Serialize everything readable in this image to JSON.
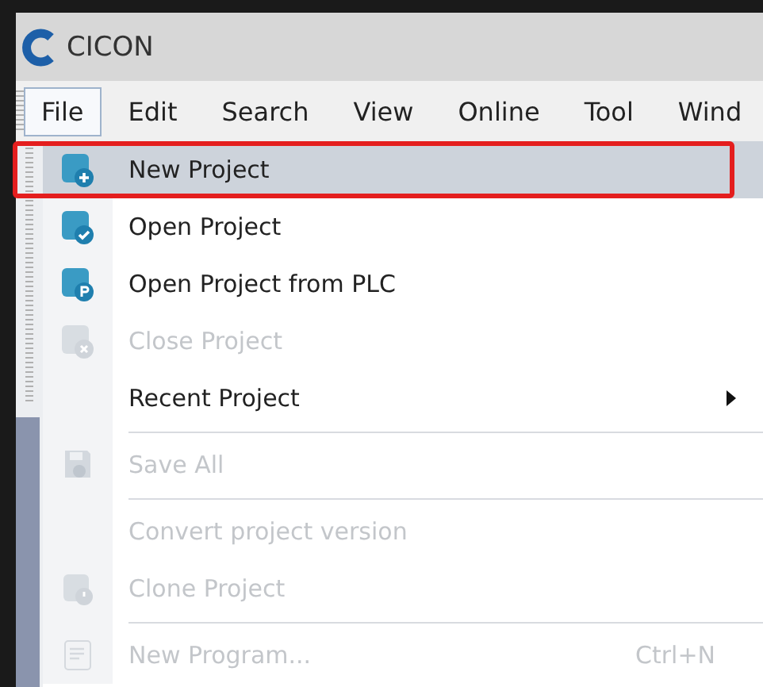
{
  "window": {
    "title": "CICON"
  },
  "menu_bar": [
    {
      "label": "File",
      "selected": true
    },
    {
      "label": "Edit",
      "selected": false
    },
    {
      "label": "Search",
      "selected": false
    },
    {
      "label": "View",
      "selected": false
    },
    {
      "label": "Online",
      "selected": false
    },
    {
      "label": "Tool",
      "selected": false
    },
    {
      "label": "Wind",
      "selected": false
    }
  ],
  "file_menu": [
    {
      "kind": "item",
      "label": "New Project",
      "disabled": false,
      "highlighted": true,
      "submenu": false
    },
    {
      "kind": "item",
      "label": "Open Project",
      "disabled": false,
      "highlighted": false,
      "submenu": false
    },
    {
      "kind": "item",
      "label": "Open Project from PLC",
      "disabled": false,
      "highlighted": false,
      "submenu": false
    },
    {
      "kind": "item",
      "label": "Close Project",
      "disabled": true,
      "highlighted": false,
      "submenu": false
    },
    {
      "kind": "item",
      "label": "Recent Project",
      "disabled": false,
      "highlighted": false,
      "submenu": true
    },
    {
      "kind": "separator"
    },
    {
      "kind": "item",
      "label": "Save All",
      "disabled": true,
      "highlighted": false,
      "submenu": false
    },
    {
      "kind": "separator"
    },
    {
      "kind": "item",
      "label": "Convert project version",
      "disabled": true,
      "highlighted": false,
      "submenu": false
    },
    {
      "kind": "item",
      "label": "Clone Project",
      "disabled": true,
      "highlighted": false,
      "submenu": false
    },
    {
      "kind": "separator"
    },
    {
      "kind": "item",
      "label": "New Program...",
      "shortcut": "Ctrl+N",
      "disabled": true,
      "highlighted": false,
      "submenu": false
    }
  ]
}
